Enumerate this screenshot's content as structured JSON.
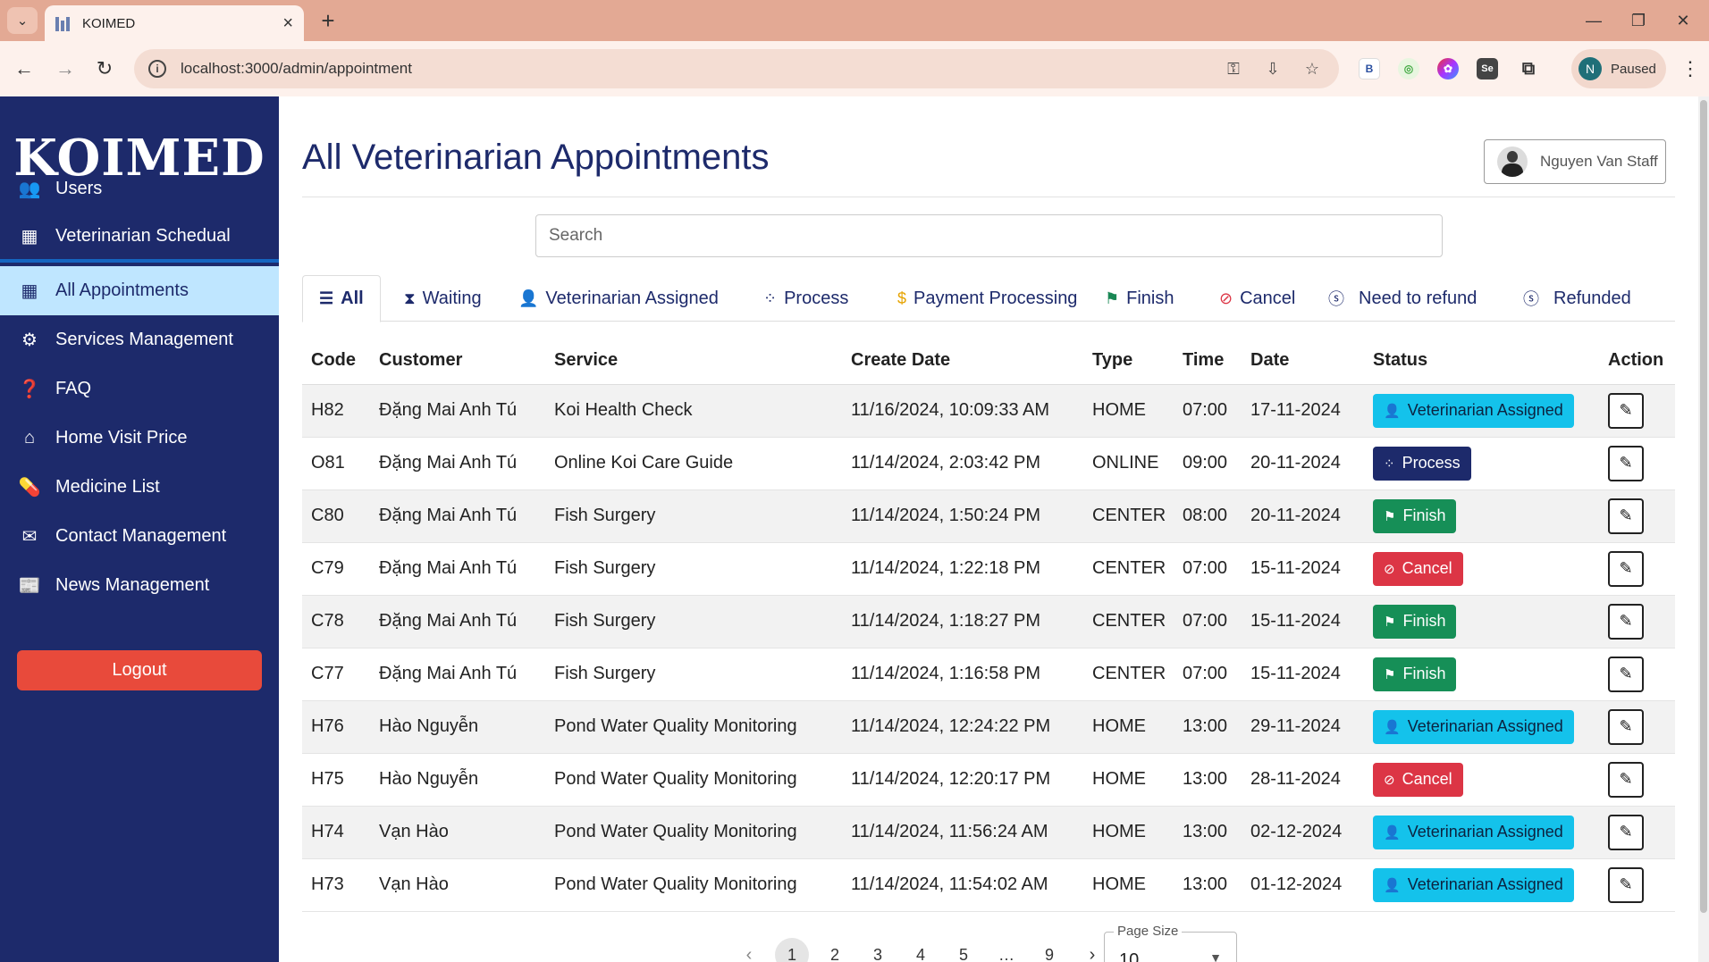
{
  "browser": {
    "tab_title": "KOIMED",
    "url": "localhost:3000/admin/appointment",
    "profile_initial": "N",
    "profile_status": "Paused",
    "extensions": [
      "B",
      "Se"
    ]
  },
  "sidebar": {
    "logo": "KOIMED",
    "items": [
      {
        "label": "Users",
        "icon": "users-icon"
      },
      {
        "label": "Veterinarian Schedual",
        "icon": "calendar-icon"
      },
      {
        "label": "All Appointments",
        "icon": "calendar-icon"
      },
      {
        "label": "Services Management",
        "icon": "gears-icon"
      },
      {
        "label": "FAQ",
        "icon": "question-icon"
      },
      {
        "label": "Home Visit Price",
        "icon": "home-icon"
      },
      {
        "label": "Medicine List",
        "icon": "pills-icon"
      },
      {
        "label": "Contact Management",
        "icon": "envelope-icon"
      },
      {
        "label": "News Management",
        "icon": "newspaper-icon"
      }
    ],
    "logout": "Logout"
  },
  "header": {
    "title": "All Veterinarian Appointments",
    "user_name": "Nguyen Van Staff"
  },
  "search": {
    "placeholder": "Search"
  },
  "filter_tabs": [
    {
      "label": "All",
      "icon": "list-icon"
    },
    {
      "label": "Waiting",
      "icon": "hourglass-icon"
    },
    {
      "label": "Veterinarian Assigned",
      "icon": "user-icon"
    },
    {
      "label": "Process",
      "icon": "spinner-icon"
    },
    {
      "label": "Payment Processing",
      "icon": "dollar-icon"
    },
    {
      "label": "Finish",
      "icon": "flag-icon"
    },
    {
      "label": "Cancel",
      "icon": "ban-icon"
    },
    {
      "label": "Need to refund",
      "icon": "coin-icon"
    },
    {
      "label": "Refunded",
      "icon": "coin-icon"
    }
  ],
  "table": {
    "columns": [
      "Code",
      "Customer",
      "Service",
      "Create Date",
      "Type",
      "Time",
      "Date",
      "Status",
      "Action"
    ],
    "rows": [
      {
        "code": "H82",
        "customer": "Đặng Mai Anh Tú",
        "service": "Koi Health Check",
        "create_date": "11/16/2024, 10:09:33 AM",
        "type": "HOME",
        "time": "07:00",
        "date": "17-11-2024",
        "status": "Veterinarian Assigned"
      },
      {
        "code": "O81",
        "customer": "Đặng Mai Anh Tú",
        "service": "Online Koi Care Guide",
        "create_date": "11/14/2024, 2:03:42 PM",
        "type": "ONLINE",
        "time": "09:00",
        "date": "20-11-2024",
        "status": "Process"
      },
      {
        "code": "C80",
        "customer": "Đặng Mai Anh Tú",
        "service": "Fish Surgery",
        "create_date": "11/14/2024, 1:50:24 PM",
        "type": "CENTER",
        "time": "08:00",
        "date": "20-11-2024",
        "status": "Finish"
      },
      {
        "code": "C79",
        "customer": "Đặng Mai Anh Tú",
        "service": "Fish Surgery",
        "create_date": "11/14/2024, 1:22:18 PM",
        "type": "CENTER",
        "time": "07:00",
        "date": "15-11-2024",
        "status": "Cancel"
      },
      {
        "code": "C78",
        "customer": "Đặng Mai Anh Tú",
        "service": "Fish Surgery",
        "create_date": "11/14/2024, 1:18:27 PM",
        "type": "CENTER",
        "time": "07:00",
        "date": "15-11-2024",
        "status": "Finish"
      },
      {
        "code": "C77",
        "customer": "Đặng Mai Anh Tú",
        "service": "Fish Surgery",
        "create_date": "11/14/2024, 1:16:58 PM",
        "type": "CENTER",
        "time": "07:00",
        "date": "15-11-2024",
        "status": "Finish"
      },
      {
        "code": "H76",
        "customer": "Hào Nguyễn",
        "service": "Pond Water Quality Monitoring",
        "create_date": "11/14/2024, 12:24:22 PM",
        "type": "HOME",
        "time": "13:00",
        "date": "29-11-2024",
        "status": "Veterinarian Assigned"
      },
      {
        "code": "H75",
        "customer": "Hào Nguyễn",
        "service": "Pond Water Quality Monitoring",
        "create_date": "11/14/2024, 12:20:17 PM",
        "type": "HOME",
        "time": "13:00",
        "date": "28-11-2024",
        "status": "Cancel"
      },
      {
        "code": "H74",
        "customer": "Vạn Hào",
        "service": "Pond Water Quality Monitoring",
        "create_date": "11/14/2024, 11:56:24 AM",
        "type": "HOME",
        "time": "13:00",
        "date": "02-12-2024",
        "status": "Veterinarian Assigned"
      },
      {
        "code": "H73",
        "customer": "Vạn Hào",
        "service": "Pond Water Quality Monitoring",
        "create_date": "11/14/2024, 11:54:02 AM",
        "type": "HOME",
        "time": "13:00",
        "date": "01-12-2024",
        "status": "Veterinarian Assigned"
      }
    ]
  },
  "pagination": {
    "pages": [
      "1",
      "2",
      "3",
      "4",
      "5",
      "…",
      "9"
    ],
    "current": "1",
    "page_size_label": "Page Size",
    "page_size": "10"
  },
  "colors": {
    "sidebar": "#1d2a6b",
    "active_item": "#bfe6ff",
    "logout": "#e84a3b",
    "assigned": "#14c2eb",
    "process": "#1d2a6b",
    "finish": "#168f57",
    "cancel": "#dc3545"
  }
}
